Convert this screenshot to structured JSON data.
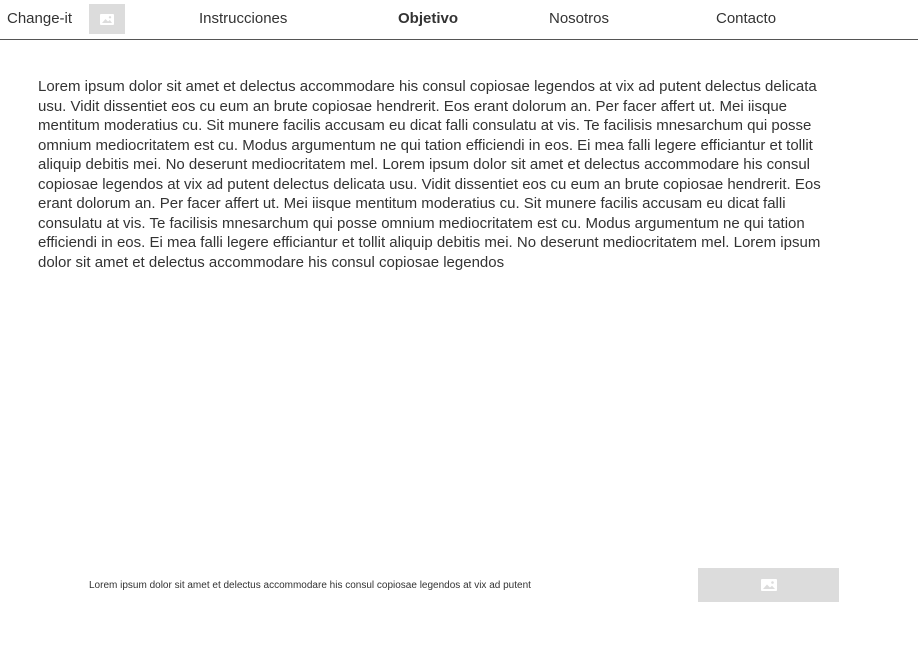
{
  "header": {
    "brand": "Change-it",
    "logo_icon": "image-placeholder-icon",
    "nav": [
      {
        "label": "Instrucciones",
        "active": false
      },
      {
        "label": "Objetivo",
        "active": true
      },
      {
        "label": "Nosotros",
        "active": false
      },
      {
        "label": "Contacto",
        "active": false
      }
    ]
  },
  "main": {
    "paragraph": "Lorem ipsum dolor sit amet et delectus accommodare his consul copiosae legendos at vix ad putent delectus delicata usu. Vidit dissentiet eos cu eum an brute copiosae hendrerit. Eos erant dolorum an. Per facer affert ut. Mei iisque mentitum moderatius cu. Sit munere facilis accusam eu dicat falli consulatu at vis. Te facilisis mnesarchum qui posse omnium mediocritatem est cu. Modus argumentum ne qui tation efficiendi in eos. Ei mea falli legere efficiantur et tollit aliquip debitis mei. No deserunt mediocritatem mel. Lorem ipsum dolor sit amet et delectus accommodare his consul copiosae legendos at vix ad putent delectus delicata usu. Vidit dissentiet eos cu eum an brute copiosae hendrerit. Eos erant dolorum an. Per facer affert ut. Mei iisque mentitum moderatius cu. Sit munere facilis accusam eu dicat falli consulatu at vis. Te facilisis mnesarchum qui posse omnium mediocritatem est cu. Modus argumentum ne qui tation efficiendi in eos. Ei mea falli legere efficiantur et tollit aliquip debitis mei. No deserunt mediocritatem mel. Lorem ipsum dolor sit amet et delectus accommodare his consul copiosae legendos"
  },
  "footer": {
    "text": "Lorem ipsum dolor sit amet et delectus accommodare his consul copiosae legendos at vix ad putent",
    "image_icon": "image-placeholder-icon"
  },
  "colors": {
    "text": "#333333",
    "placeholder_bg": "#dcdcdc",
    "placeholder_glyph": "#ffffff",
    "divider": "#555555"
  }
}
